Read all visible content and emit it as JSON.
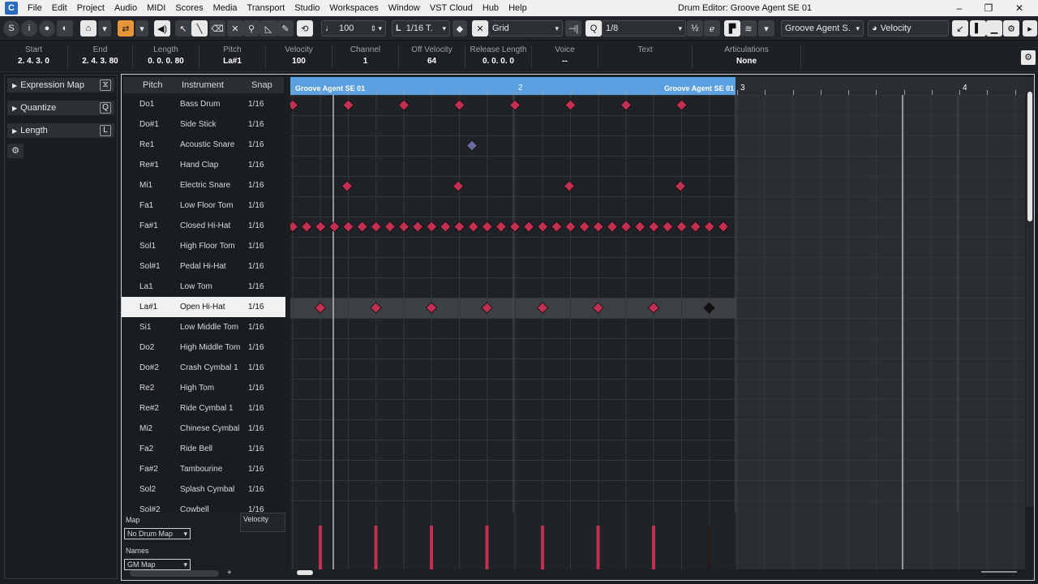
{
  "menu": {
    "items": [
      "File",
      "Edit",
      "Project",
      "Audio",
      "MIDI",
      "Scores",
      "Media",
      "Transport",
      "Studio",
      "Workspaces",
      "Window",
      "VST Cloud",
      "Hub",
      "Help"
    ],
    "window_title": "Drum Editor: Groove Agent SE 01"
  },
  "toolbar": {
    "tempo": "100",
    "length_quant": "1/16 T.",
    "grid_mode": "Grid",
    "quantize": "1/8",
    "instrument": "Groove Agent S.",
    "lane_param": "Velocity"
  },
  "infoline": [
    {
      "label": "Start",
      "value": "2. 4. 3.   0"
    },
    {
      "label": "End",
      "value": "2. 4. 3. 80"
    },
    {
      "label": "Length",
      "value": "0. 0. 0. 80"
    },
    {
      "label": "Pitch",
      "value": "La#1"
    },
    {
      "label": "Velocity",
      "value": "100"
    },
    {
      "label": "Channel",
      "value": "1"
    },
    {
      "label": "Off Velocity",
      "value": "64"
    },
    {
      "label": "Release Length",
      "value": "0. 0. 0.   0"
    },
    {
      "label": "Voice",
      "value": "--"
    },
    {
      "label": "Text",
      "value": ""
    },
    {
      "label": "Articulations",
      "value": "None"
    }
  ],
  "inspector": {
    "sections": [
      {
        "label": "Expression Map",
        "key": "⧖"
      },
      {
        "label": "Quantize",
        "key": "Q"
      },
      {
        "label": "Length",
        "key": "L"
      }
    ]
  },
  "drumlist": {
    "headers": {
      "pitch": "Pitch",
      "instrument": "Instrument",
      "snap": "Snap"
    },
    "rows": [
      {
        "pitch": "Do1",
        "instrument": "Bass Drum",
        "snap": "1/16"
      },
      {
        "pitch": "Do#1",
        "instrument": "Side Stick",
        "snap": "1/16"
      },
      {
        "pitch": "Re1",
        "instrument": "Acoustic Snare",
        "snap": "1/16"
      },
      {
        "pitch": "Re#1",
        "instrument": "Hand Clap",
        "snap": "1/16"
      },
      {
        "pitch": "Mi1",
        "instrument": "Electric Snare",
        "snap": "1/16"
      },
      {
        "pitch": "Fa1",
        "instrument": "Low Floor Tom",
        "snap": "1/16"
      },
      {
        "pitch": "Fa#1",
        "instrument": "Closed Hi-Hat",
        "snap": "1/16"
      },
      {
        "pitch": "Sol1",
        "instrument": "High Floor Tom",
        "snap": "1/16"
      },
      {
        "pitch": "Sol#1",
        "instrument": "Pedal Hi-Hat",
        "snap": "1/16"
      },
      {
        "pitch": "La1",
        "instrument": "Low Tom",
        "snap": "1/16"
      },
      {
        "pitch": "La#1",
        "instrument": "Open Hi-Hat",
        "snap": "1/16"
      },
      {
        "pitch": "Si1",
        "instrument": "Low Middle Tom",
        "snap": "1/16"
      },
      {
        "pitch": "Do2",
        "instrument": "High Middle Tom",
        "snap": "1/16"
      },
      {
        "pitch": "Do#2",
        "instrument": "Crash Cymbal 1",
        "snap": "1/16"
      },
      {
        "pitch": "Re2",
        "instrument": "High Tom",
        "snap": "1/16"
      },
      {
        "pitch": "Re#2",
        "instrument": "Ride Cymbal 1",
        "snap": "1/16"
      },
      {
        "pitch": "Mi2",
        "instrument": "Chinese Cymbal",
        "snap": "1/16"
      },
      {
        "pitch": "Fa2",
        "instrument": "Ride Bell",
        "snap": "1/16"
      },
      {
        "pitch": "Fa#2",
        "instrument": "Tambourine",
        "snap": "1/16"
      },
      {
        "pitch": "Sol2",
        "instrument": "Splash Cymbal",
        "snap": "1/16"
      },
      {
        "pitch": "Sol#2",
        "instrument": "Cowbell",
        "snap": "1/16"
      }
    ],
    "selected_row": 10
  },
  "ruler": {
    "part_name_left": "Groove Agent SE 01",
    "part_name_right": "Groove Agent SE 01",
    "bars": [
      "2",
      "3",
      "4"
    ]
  },
  "bottom": {
    "map_label": "Map",
    "map_value": "No Drum Map",
    "names_label": "Names",
    "names_value": "GM Map",
    "velocity_label": "Velocity"
  },
  "colors": {
    "note": "#c03050",
    "note_dim": "#6a6aa0",
    "note_selected": "#111111",
    "part": "#5aa0e0"
  }
}
